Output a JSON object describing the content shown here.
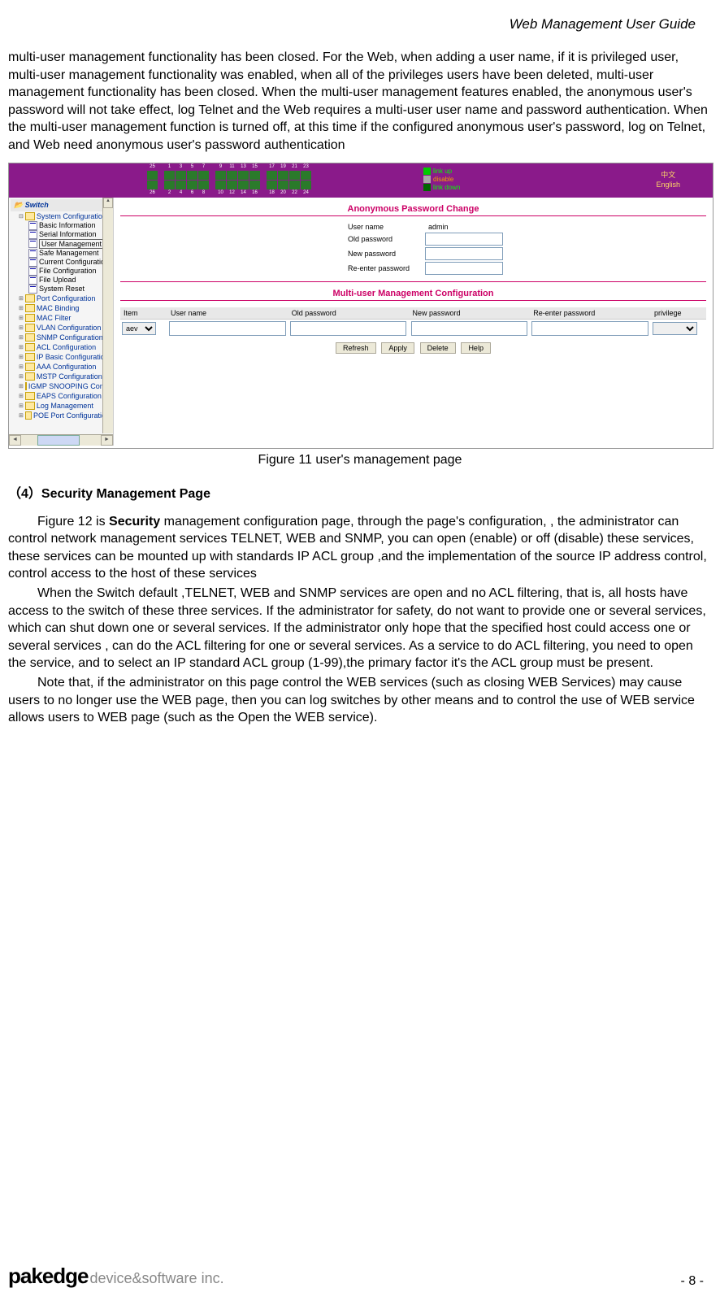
{
  "header": {
    "doc_title": "Web Management User Guide"
  },
  "intro_text": "multi-user management functionality has been closed. For the Web, when adding a user name, if it is privileged user, multi-user management functionality was enabled, when all of the privileges users have been deleted, multi-user management functionality has been closed. When the multi-user management features enabled, the anonymous user's password will not take effect, log Telnet and the Web requires a multi-user user name and password authentication. When the multi-user management function is turned off, at this time if the configured anonymous user's password, log on Telnet, and Web need anonymous user's password authentication",
  "screenshot": {
    "top_ports_odd": [
      "1",
      "3",
      "5",
      "7",
      "9",
      "11",
      "13",
      "15",
      "17",
      "19",
      "21",
      "23"
    ],
    "top_ports_even": [
      "2",
      "4",
      "6",
      "8",
      "10",
      "12",
      "14",
      "16",
      "18",
      "20",
      "22",
      "24"
    ],
    "extra_ports": [
      "25",
      "26"
    ],
    "legend": {
      "link_up": "link up",
      "disable": "disable",
      "link_down": "link down"
    },
    "lang": {
      "cn": "中文",
      "en": "English"
    },
    "sidebar": {
      "title": "Switch",
      "sys_config": "System Configuration",
      "sys_children": [
        "Basic Information",
        "Serial Information",
        "User Management",
        "Safe Management",
        "Current Configuration",
        "File Configuration",
        "File Upload",
        "System Reset"
      ],
      "folders": [
        "Port Configuration",
        "MAC Binding",
        "MAC Filter",
        "VLAN Configuration",
        "SNMP Configuration",
        "ACL Configuration",
        "IP Basic Configuration",
        "AAA Configuration",
        "MSTP Configuration",
        "IGMP SNOOPING Config",
        "EAPS Configuration",
        "Log Management",
        "POE Port Configuration"
      ]
    },
    "main": {
      "title1": "Anonymous Password Change",
      "user_name_label": "User name",
      "user_name_value": "admin",
      "old_pw_label": "Old password",
      "new_pw_label": "New password",
      "re_pw_label": "Re-enter password",
      "title2": "Multi-user Management Configuration",
      "table_headers": [
        "Item",
        "User name",
        "Old password",
        "New password",
        "Re-enter password",
        "privilege"
      ],
      "item_select": "aev",
      "buttons": {
        "refresh": "Refresh",
        "apply": "Apply",
        "delete": "Delete",
        "help": "Help"
      }
    }
  },
  "figure_caption": "Figure 11 user's management page",
  "section_heading": "（4）Security Management Page",
  "para1_prefix": "Figure 12 is ",
  "para1_bold": "Security",
  "para1_rest": " management configuration page, through the page's configuration, , the administrator can control network management services TELNET, WEB and SNMP, you can open (enable) or off (disable) these services, these services can be mounted up with standards IP ACL group ,and the implementation of the source IP address control, control access to the host of these services",
  "para2": "When the Switch default ,TELNET, WEB and SNMP services are open and no ACL filtering, that is, all hosts have access to the switch of these three services. If the administrator for safety, do not want to provide one or several services, which can shut down one or several services. If the administrator only hope that the specified host could access one or several services , can do the ACL filtering for one or several services. As a service to do ACL filtering, you need to open the service, and to select an IP standard ACL group (1-99),the primary factor it's the ACL group must be present.",
  "para3": "Note that, if the administrator on this page control the WEB services (such as closing WEB Services) may cause users to no longer use the WEB page, then you can log switches by other means and to control the use of WEB service allows users to WEB page (such as the Open the WEB service).",
  "footer": {
    "logo_main": "pakedge",
    "logo_sub": "device&software inc.",
    "page_num": "- 8 -"
  }
}
